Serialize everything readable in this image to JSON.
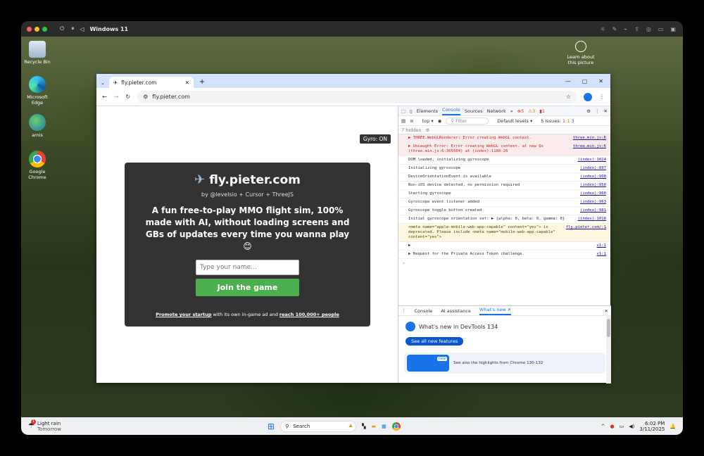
{
  "vm": {
    "title": "Windows 11"
  },
  "desktop": {
    "icons": [
      {
        "label": "Recycle Bin",
        "icon": "recycle-bin-icon"
      },
      {
        "label": "Microsoft Edge",
        "icon": "edge-icon"
      },
      {
        "label": "arnis",
        "icon": "arnis-icon"
      },
      {
        "label": "Google Chrome",
        "icon": "chrome-icon"
      }
    ],
    "learn": "Learn about this picture"
  },
  "browser": {
    "tab_title": "fly.pieter.com",
    "url": "fly.pieter.com",
    "gyro": "Gyro: ON",
    "card": {
      "title": "fly.pieter.com",
      "byline": "by @levelsio + Cursor + ThreeJS",
      "headline": "A fun free-to-play MMO flight sim, 100% made with AI, without loading screens and GBs of updates every time you wanna play 😊",
      "name_placeholder": "Type your name...",
      "join": "Join the game",
      "promo_link": "Promote your startup",
      "promo_mid": "with its own in-game ad and",
      "promo_reach": "reach 100,000+ people"
    }
  },
  "devtools": {
    "tabs": [
      "Elements",
      "Console",
      "Sources",
      "Network"
    ],
    "errors": "5",
    "warnings": "3",
    "infos": "1",
    "context": "top",
    "filter": "Filter",
    "levels": "Default levels",
    "issues": "5 Issues:",
    "issue_counts": [
      "1",
      "1",
      "3"
    ],
    "hidden": "7 hidden",
    "logs": [
      {
        "type": "err",
        "text": "▶ THREE.WebGLRenderer: Error creating WebGL context.",
        "src": "three.min.js:6"
      },
      {
        "type": "err",
        "text": "▶ Uncaught Error: Error creating WebGL context. at new Qs (three.min.js:6:365504) at (index):1180:26",
        "src": "three.min.js:6"
      },
      {
        "type": "log",
        "text": "DOM loaded, initializing gyroscope",
        "src": "(index):1024"
      },
      {
        "type": "log",
        "text": "Initializing gyroscope",
        "src": "(index):897"
      },
      {
        "type": "log",
        "text": "DeviceOrientationEvent is available",
        "src": "(index):900"
      },
      {
        "type": "log",
        "text": "Non-iOS device detected, no permission required",
        "src": "(index):950"
      },
      {
        "type": "log",
        "text": "Starting gyroscope",
        "src": "(index):960"
      },
      {
        "type": "log",
        "text": "Gyroscope event listener added",
        "src": "(index):963"
      },
      {
        "type": "log",
        "text": "Gyroscope toggle button created",
        "src": "(index):981"
      },
      {
        "type": "log",
        "text": "Initial gyroscope orientation set: ▶ {alpha: 0, beta: 0, gamma: 0}",
        "src": "(index):1018"
      },
      {
        "type": "warn",
        "text": "<meta name=\"apple-mobile-web-app-capable\" content=\"yes\"> is deprecated. Please include <meta name=\"mobile-web-app-capable\" content=\"yes\">",
        "src": "fly.pieter.com/:1"
      },
      {
        "type": "log",
        "text": "▶",
        "src": "v1:1"
      },
      {
        "type": "log",
        "text": "▶ Request for the Private Access Token challenge.",
        "src": "v1:1"
      }
    ],
    "drawer_tabs": [
      "Console",
      "AI assistance",
      "What's new"
    ],
    "whats_new_title": "What's new in DevTools 134",
    "see_all": "See all new features",
    "highlights": "See also the highlights from Chrome 130-132",
    "new_badge": "new"
  },
  "taskbar": {
    "weather": "Light rain",
    "weather_sub": "Tomorrow",
    "weather_badge": "1",
    "search": "Search",
    "time": "6:02 PM",
    "date": "3/11/2025"
  }
}
